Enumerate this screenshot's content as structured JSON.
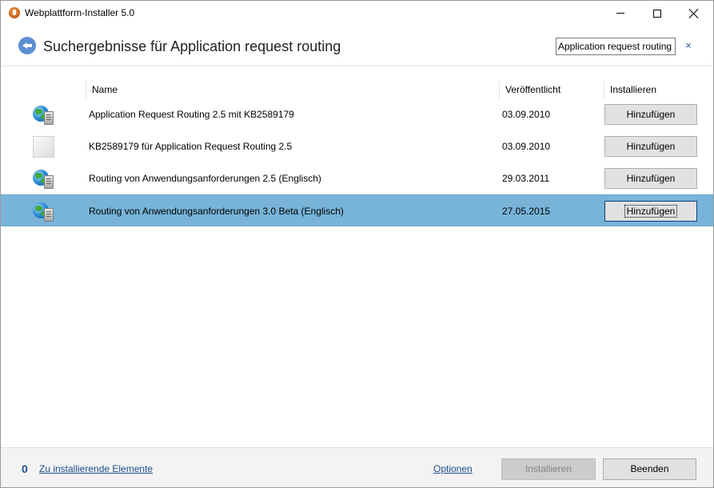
{
  "window": {
    "title": "Webplattform-Installer 5.0",
    "icon": "web-platform-installer-icon"
  },
  "header": {
    "title": "Suchergebnisse für Application request routing",
    "search_value": "Application request routing",
    "clear_glyph": "×"
  },
  "table": {
    "columns": {
      "name": "Name",
      "published": "Veröffentlicht",
      "install": "Installieren"
    },
    "rows": [
      {
        "name": "Application Request Routing 2.5 mit KB2589179",
        "date": "03.09.2010",
        "action": "Hinzufügen",
        "icon": "globe-server-icon"
      },
      {
        "name": "KB2589179 für Application Request Routing 2.5",
        "date": "03.09.2010",
        "action": "Hinzufügen",
        "icon": "blank-page-icon"
      },
      {
        "name": "Routing von Anwendungsanforderungen 2.5 (Englisch)",
        "date": "29.03.2011",
        "action": "Hinzufügen",
        "icon": "globe-server-icon"
      },
      {
        "name": "Routing von Anwendungsanforderungen 3.0 Beta (Englisch)",
        "date": "27.05.2015",
        "action": "Hinzufügen",
        "icon": "globe-server-icon",
        "selected": true
      }
    ]
  },
  "footer": {
    "count": "0",
    "items_link": "Zu installierende Elemente",
    "options_link": "Optionen",
    "install_button": "Installieren",
    "quit_button": "Beenden"
  },
  "colors": {
    "selected_row": "#77b4d8",
    "link": "#1f4e8c",
    "back_button": "#5b8fd0"
  }
}
